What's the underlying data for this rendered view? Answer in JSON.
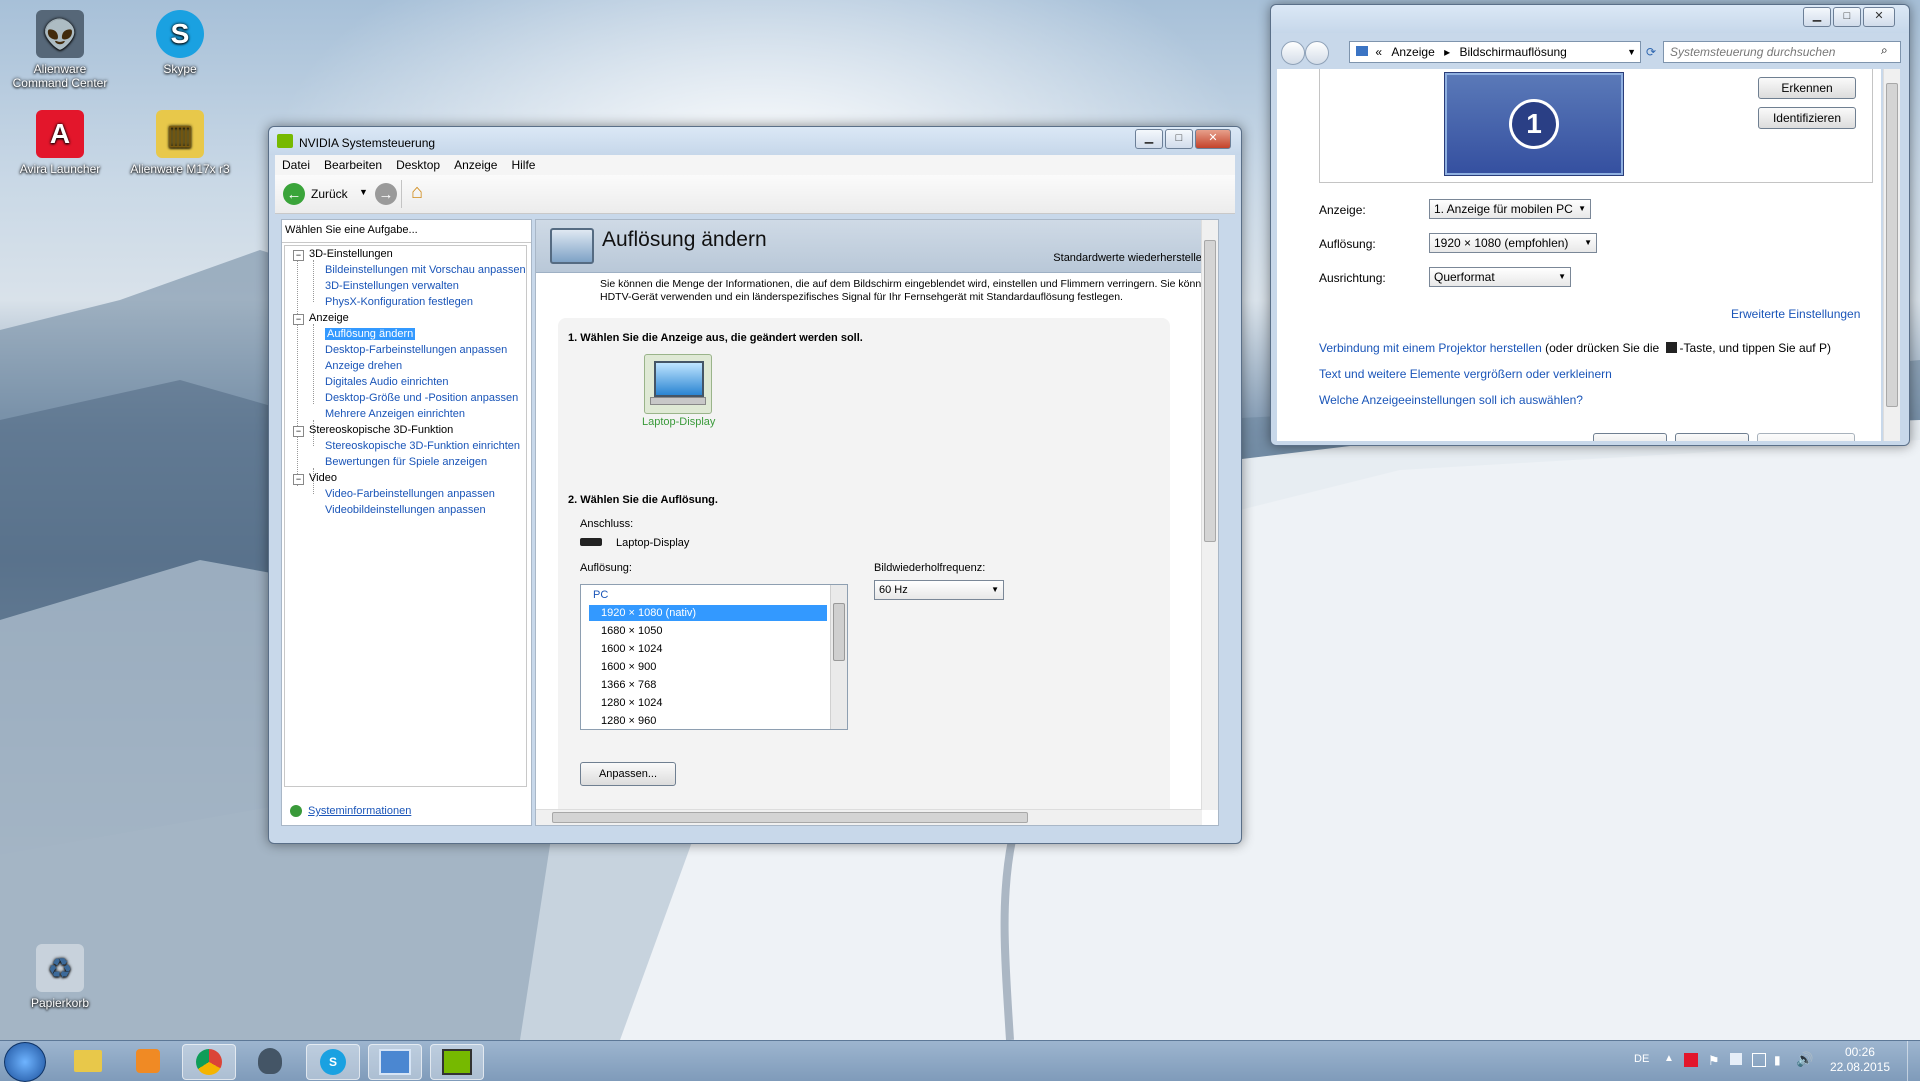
{
  "desktop": {
    "icons": [
      {
        "label": "Alienware Command Center",
        "name": "alienware-command-center-icon"
      },
      {
        "label": "Skype",
        "name": "skype-icon"
      },
      {
        "label": "Avira Launcher",
        "name": "avira-launcher-icon"
      },
      {
        "label": "Alienware M17x r3",
        "name": "folder-icon"
      },
      {
        "label": "Papierkorb",
        "name": "recycle-bin-icon"
      }
    ]
  },
  "nvidia": {
    "title": "NVIDIA Systemsteuerung",
    "menu": [
      "Datei",
      "Bearbeiten",
      "Desktop",
      "Anzeige",
      "Hilfe"
    ],
    "back_label": "Zurück",
    "task_header": "Wählen Sie eine Aufgabe...",
    "tree": {
      "cat1": "3D-Einstellungen",
      "c1": [
        "Bildeinstellungen mit Vorschau anpassen",
        "3D-Einstellungen verwalten",
        "PhysX-Konfiguration festlegen"
      ],
      "cat2": "Anzeige",
      "c2": [
        "Auflösung ändern",
        "Desktop-Farbeinstellungen anpassen",
        "Anzeige drehen",
        "Digitales Audio einrichten",
        "Desktop-Größe und -Position anpassen",
        "Mehrere Anzeigen einrichten"
      ],
      "cat3": "Stereoskopische 3D-Funktion",
      "c3": [
        "Stereoskopische 3D-Funktion einrichten",
        "Bewertungen für Spiele anzeigen"
      ],
      "cat4": "Video",
      "c4": [
        "Video-Farbeinstellungen anpassen",
        "Videobildeinstellungen anpassen"
      ]
    },
    "sysinfo": "Systeminformationen",
    "page_title": "Auflösung ändern",
    "restore_defaults": "Standardwerte wiederherstellen",
    "description": "Sie können die Menge der Informationen, die auf dem Bildschirm eingeblendet wird, einstellen und Flimmern verringern. Sie können HDTV-Gerät verwenden und ein länderspezifisches Signal für Ihr Fernsehgerät mit Standardauflösung festlegen.",
    "step1": "1. Wählen Sie die Anzeige aus, die geändert werden soll.",
    "display_label": "Laptop-Display",
    "step2": "2. Wählen Sie die Auflösung.",
    "connection_label": "Anschluss:",
    "connection_value": "Laptop-Display",
    "resolution_label": "Auflösung:",
    "refresh_label": "Bildwiederholfrequenz:",
    "refresh_value": "60 Hz",
    "list_group": "PC",
    "resolutions": [
      "1920 × 1080 (nativ)",
      "1680 × 1050",
      "1600 × 1024",
      "1600 × 900",
      "1366 × 768",
      "1280 × 1024",
      "1280 × 960"
    ],
    "customize_button": "Anpassen..."
  },
  "display_settings": {
    "breadcrumb": [
      "Anzeige",
      "Bildschirmauflösung"
    ],
    "search_placeholder": "Systemsteuerung durchsuchen",
    "detect_button": "Erkennen",
    "identify_button": "Identifizieren",
    "monitor_number": "1",
    "display_label": "Anzeige:",
    "display_value": "1. Anzeige für mobilen PC",
    "resolution_label": "Auflösung:",
    "resolution_value": "1920 × 1080 (empfohlen)",
    "orientation_label": "Ausrichtung:",
    "orientation_value": "Querformat",
    "advanced_link": "Erweiterte Einstellungen",
    "projector_link": "Verbindung mit einem Projektor herstellen",
    "projector_hint": " (oder drücken Sie die ",
    "projector_hint2": "-Taste, und tippen Sie auf P)",
    "text_link": "Text und weitere Elemente vergrößern oder verkleinern",
    "which_link": "Welche Anzeigeeinstellungen soll ich auswählen?"
  },
  "taskbar": {
    "language": "DE",
    "time": "00:26",
    "date": "22.08.2015"
  },
  "colors": {
    "link": "#1a55b8",
    "selection": "#3399ff",
    "nvidia_green": "#76b900"
  }
}
